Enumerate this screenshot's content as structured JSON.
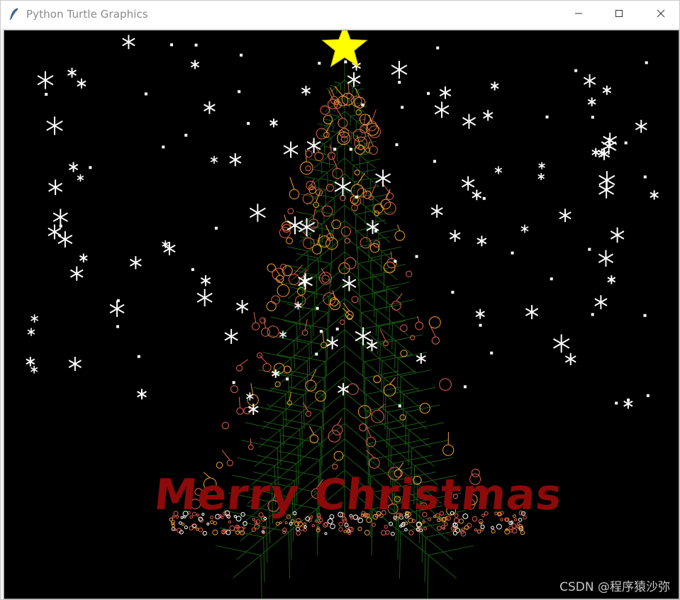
{
  "window": {
    "title": "Python Turtle Graphics",
    "icon": "feather-icon",
    "controls": [
      "minimize-icon",
      "maximize-icon",
      "close-icon"
    ]
  },
  "canvas": {
    "background": "#000000",
    "greeting": "Merry Christmas",
    "greeting_color": "#8c0a0a",
    "star_color": "#ffff00",
    "tree_color": "#1c5a16",
    "ornament_colors": [
      "#e06050",
      "#f0a030",
      "#ffffff"
    ],
    "snow_color": "#ffffff",
    "watermark": "CSDN @程序猿沙弥"
  }
}
